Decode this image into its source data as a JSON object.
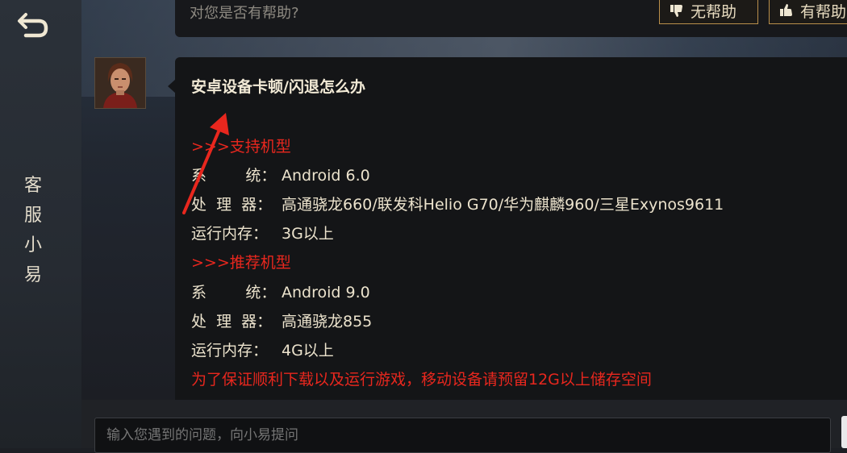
{
  "sidebar": {
    "back_icon": "back-arrow-icon",
    "title_chars": [
      "客",
      "服",
      "小",
      "易"
    ]
  },
  "previous_message": {
    "text": "对您是否有帮助?",
    "not_helpful_label": "无帮助",
    "helpful_label": "有帮助"
  },
  "message": {
    "title": "安卓设备卡顿/闪退怎么办",
    "lines": [
      {
        "text": ">>>支持机型",
        "color": "red"
      },
      {
        "label": "系        统：",
        "value": "Android 6.0"
      },
      {
        "label": "处  理  器：",
        "value": "高通骁龙660/联发科Helio G70/华为麒麟960/三星Exynos9611"
      },
      {
        "label": "运行内存：",
        "value": "3G以上"
      },
      {
        "text": ">>>推荐机型",
        "color": "red"
      },
      {
        "label": "系        统：",
        "value": "Android 9.0"
      },
      {
        "label": "处  理  器：",
        "value": "高通骁龙855"
      },
      {
        "label": "运行内存：",
        "value": "4G以上"
      },
      {
        "text": "为了保证顺利下载以及运行游戏，移动设备请预留12G以上储存空间",
        "color": "red"
      }
    ]
  },
  "input": {
    "placeholder": "输入您遇到的问题，向小易提问"
  },
  "colors": {
    "accent_red": "#e8271e",
    "button_border": "#b98f4b"
  }
}
